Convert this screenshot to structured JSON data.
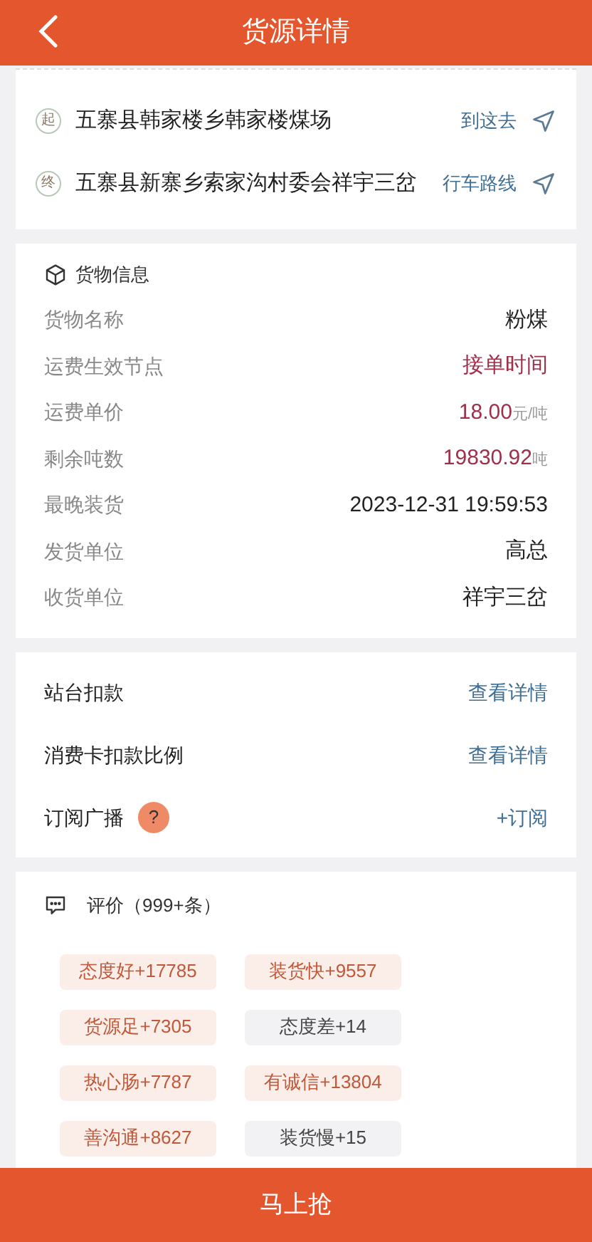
{
  "header": {
    "title": "货源详情"
  },
  "route": [
    {
      "marker": "起",
      "address": "五寨县韩家楼乡韩家楼煤场",
      "action": "到这去"
    },
    {
      "marker": "终",
      "address": "五寨县新寨乡索家沟村委会祥宇三岔",
      "action": "行车路线"
    }
  ],
  "cargo": {
    "title": "货物信息",
    "rows": [
      {
        "label": "货物名称",
        "value": "粉煤",
        "kind": "plain"
      },
      {
        "label": "运费生效节点",
        "value": "接单时间",
        "kind": "highlight"
      },
      {
        "label": "运费单价",
        "value": "18.00",
        "unit": "元/吨",
        "kind": "highlight"
      },
      {
        "label": "剩余吨数",
        "value": "19830.92",
        "unit": "吨",
        "kind": "highlight"
      },
      {
        "label": "最晚装货",
        "value": "2023-12-31 19:59:53",
        "kind": "plain"
      },
      {
        "label": "发货单位",
        "value": "高总",
        "kind": "plain"
      },
      {
        "label": "收货单位",
        "value": "祥宇三岔",
        "kind": "plain"
      }
    ]
  },
  "actions": [
    {
      "label": "站台扣款",
      "action": "查看详情",
      "kind": "link"
    },
    {
      "label": "消费卡扣款比例",
      "action": "查看详情",
      "kind": "link"
    },
    {
      "label": "订阅广播",
      "help": "?",
      "action": "+订阅",
      "kind": "help"
    }
  ],
  "reviews": {
    "title": "评价（999+条）",
    "tags": [
      {
        "text": "态度好+17785",
        "kind": "positive"
      },
      {
        "text": "装货快+9557",
        "kind": "positive"
      },
      {
        "text": "货源足+7305",
        "kind": "positive"
      },
      {
        "text": "态度差+14",
        "kind": "negative"
      },
      {
        "text": "热心肠+7787",
        "kind": "positive"
      },
      {
        "text": "有诚信+13804",
        "kind": "positive"
      },
      {
        "text": "善沟通+8627",
        "kind": "positive"
      },
      {
        "text": "装货慢+15",
        "kind": "negative"
      }
    ]
  },
  "bottom_button": "马上抢"
}
